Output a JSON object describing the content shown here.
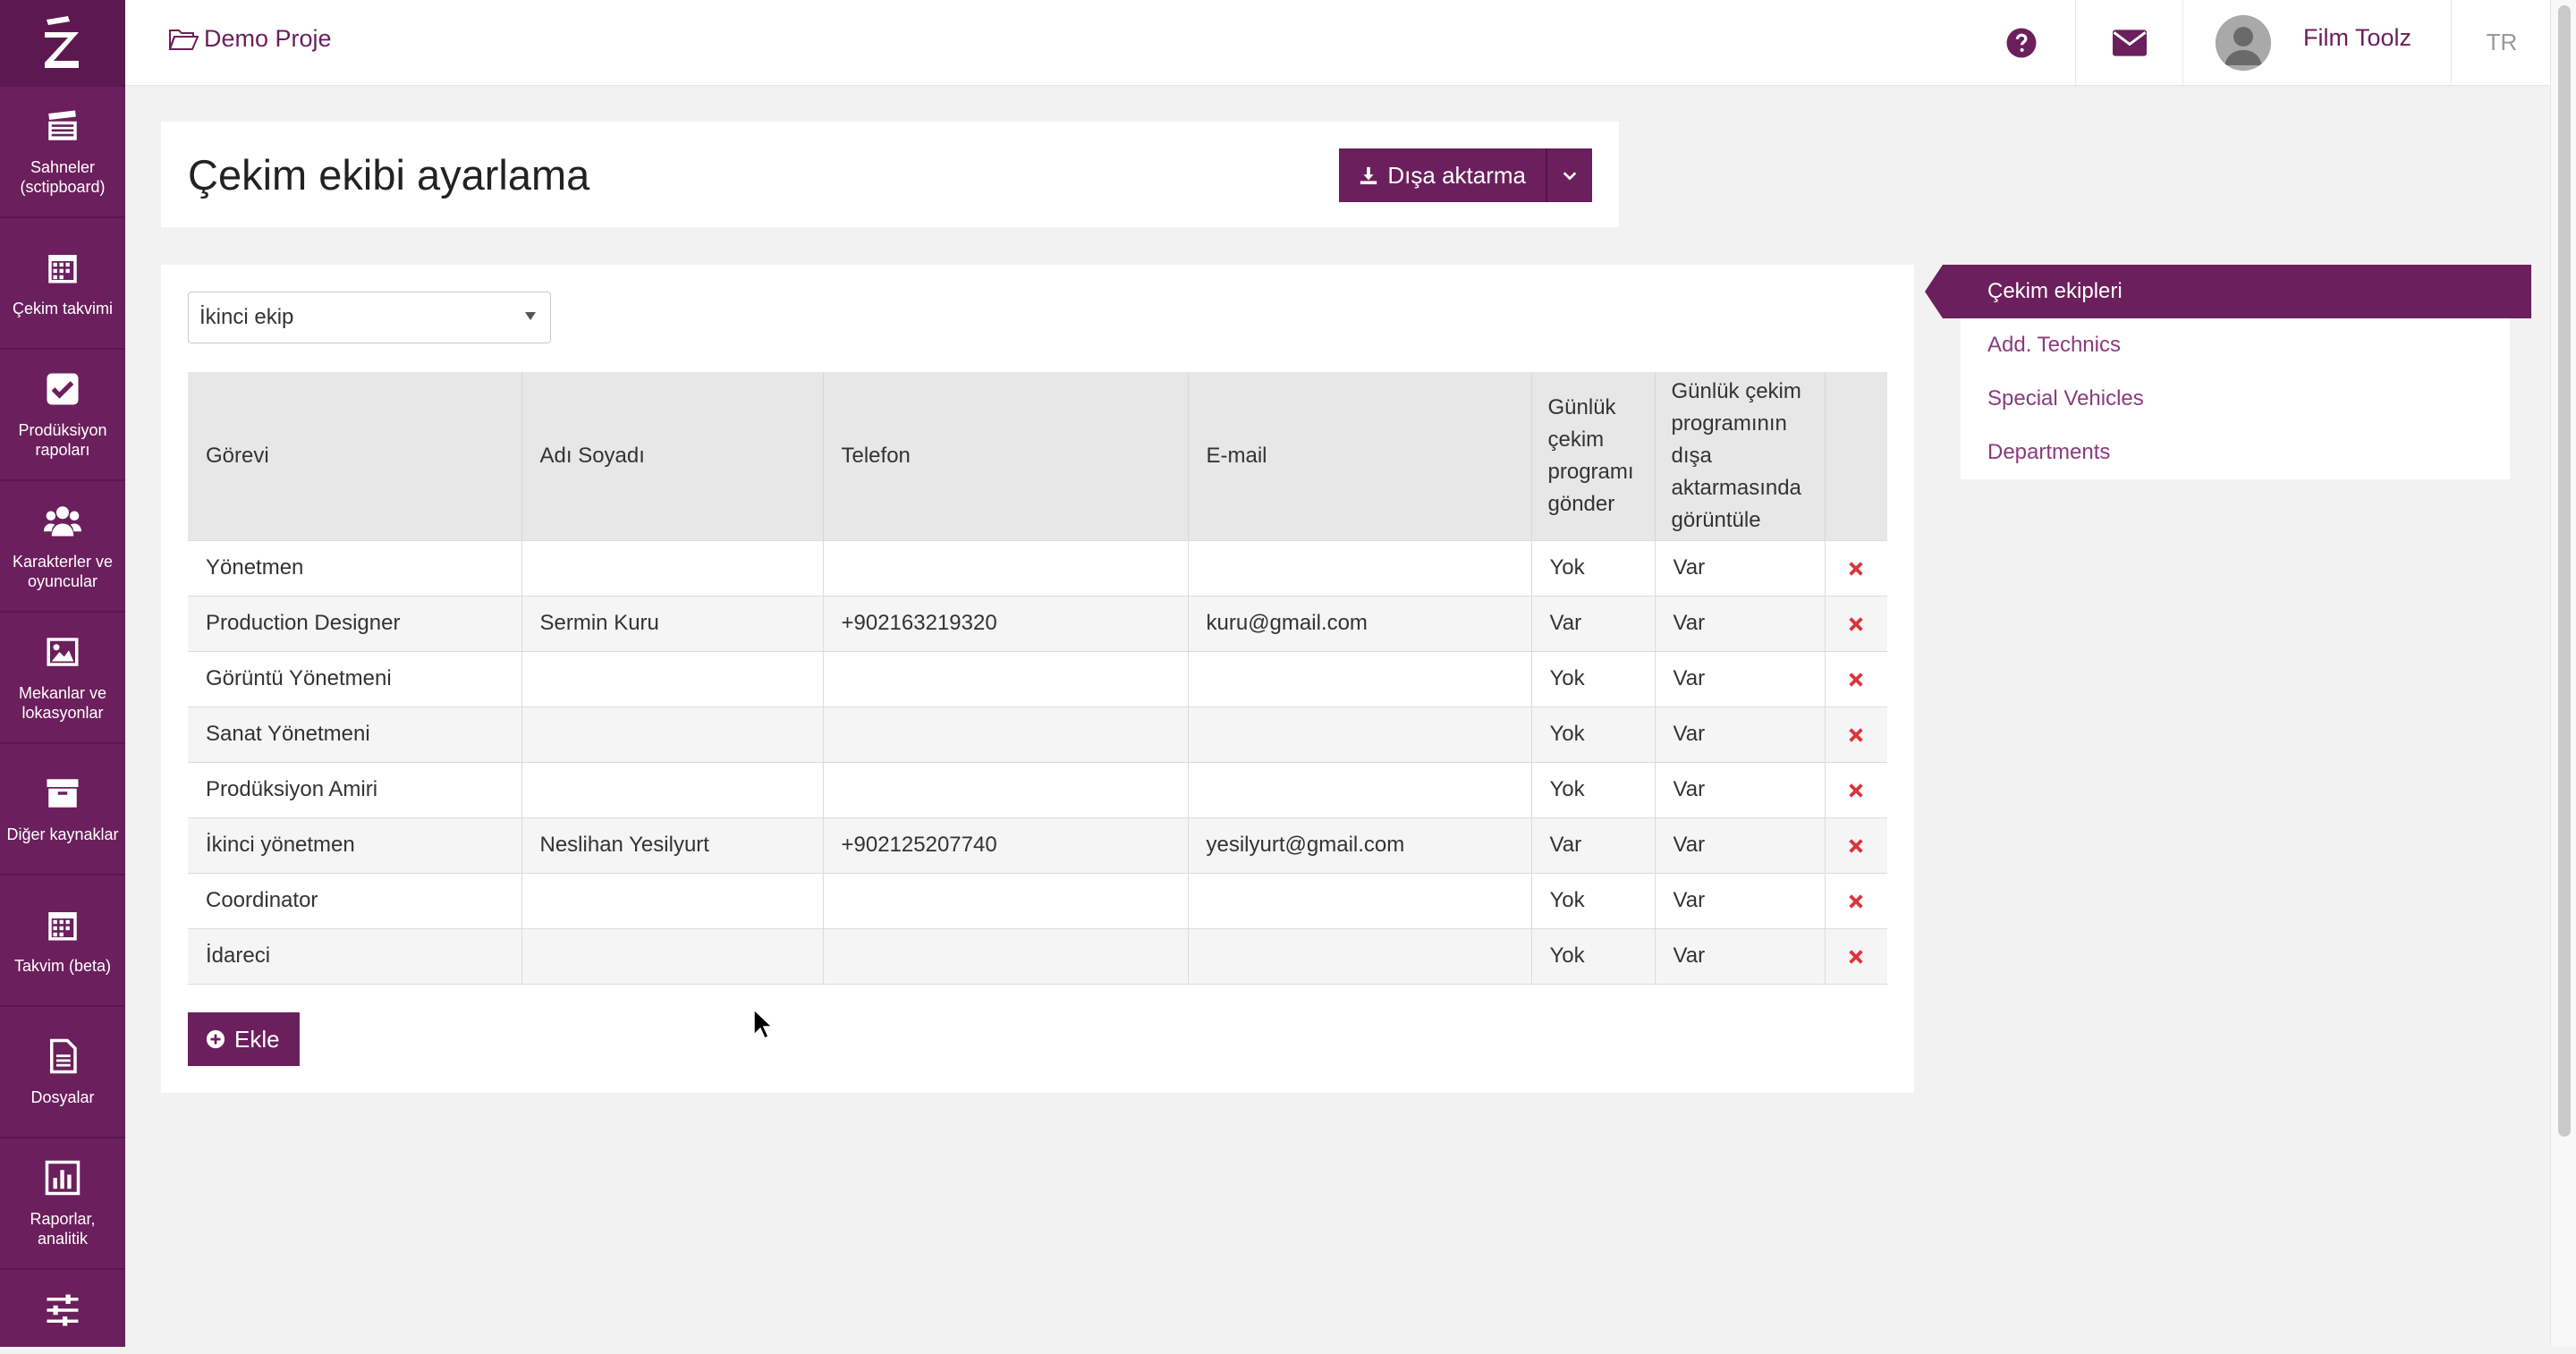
{
  "sidebar": {
    "items": [
      {
        "label": "Sahneler (sctipboard)",
        "icon": "clapperboard-icon"
      },
      {
        "label": "Çekim takvimi",
        "icon": "calendar-icon"
      },
      {
        "label": "Prodüksiyon rapoları",
        "icon": "checkbox-icon"
      },
      {
        "label": "Karakterler ve oyuncular",
        "icon": "users-icon"
      },
      {
        "label": "Mekanlar ve lokasyonlar",
        "icon": "image-icon"
      },
      {
        "label": "Diğer kaynaklar",
        "icon": "archive-icon"
      },
      {
        "label": "Takvim (beta)",
        "icon": "calendar-icon"
      },
      {
        "label": "Dosyalar",
        "icon": "file-icon"
      },
      {
        "label": "Raporlar, analitik",
        "icon": "bar-chart-icon"
      },
      {
        "label": "",
        "icon": "sliders-icon"
      }
    ]
  },
  "topbar": {
    "project": "Demo Proje",
    "user_name": "Film Toolz",
    "language": "TR"
  },
  "header": {
    "title": "Çekim ekibi ayarlama",
    "export_label": "Dışa aktarma"
  },
  "crew_select": {
    "value": "İkinci ekip"
  },
  "table": {
    "headers": {
      "role": "Görevi",
      "name": "Adı Soyadı",
      "phone": "Telefon",
      "email": "E-mail",
      "send": "Günlük çekim programı gönder",
      "show": "Günlük çekim programının dışa aktarmasında görüntüle"
    },
    "rows": [
      {
        "role": "Yönetmen",
        "name": "",
        "phone": "",
        "email": "",
        "send": "Yok",
        "show": "Var"
      },
      {
        "role": "Production Designer",
        "name": "Sermin Kuru",
        "phone": "+902163219320",
        "email": "kuru@gmail.com",
        "send": "Var",
        "show": "Var"
      },
      {
        "role": "Görüntü Yönetmeni",
        "name": "",
        "phone": "",
        "email": "",
        "send": "Yok",
        "show": "Var"
      },
      {
        "role": "Sanat Yönetmeni",
        "name": "",
        "phone": "",
        "email": "",
        "send": "Yok",
        "show": "Var"
      },
      {
        "role": "Prodüksiyon Amiri",
        "name": "",
        "phone": "",
        "email": "",
        "send": "Yok",
        "show": "Var"
      },
      {
        "role": "İkinci yönetmen",
        "name": "Neslihan Yesilyurt",
        "phone": "+902125207740",
        "email": "yesilyurt@gmail.com",
        "send": "Var",
        "show": "Var"
      },
      {
        "role": "Coordinator",
        "name": "",
        "phone": "",
        "email": "",
        "send": "Yok",
        "show": "Var"
      },
      {
        "role": "İdareci",
        "name": "",
        "phone": "",
        "email": "",
        "send": "Yok",
        "show": "Var"
      }
    ]
  },
  "add_button": "Ekle",
  "side_menu": {
    "items": [
      "Çekim ekipleri",
      "Add. Technics",
      "Special Vehicles",
      "Departments"
    ]
  },
  "colors": {
    "brand": "#6b1f5c",
    "link": "#8b3a7e",
    "delete": "#d9363e"
  }
}
